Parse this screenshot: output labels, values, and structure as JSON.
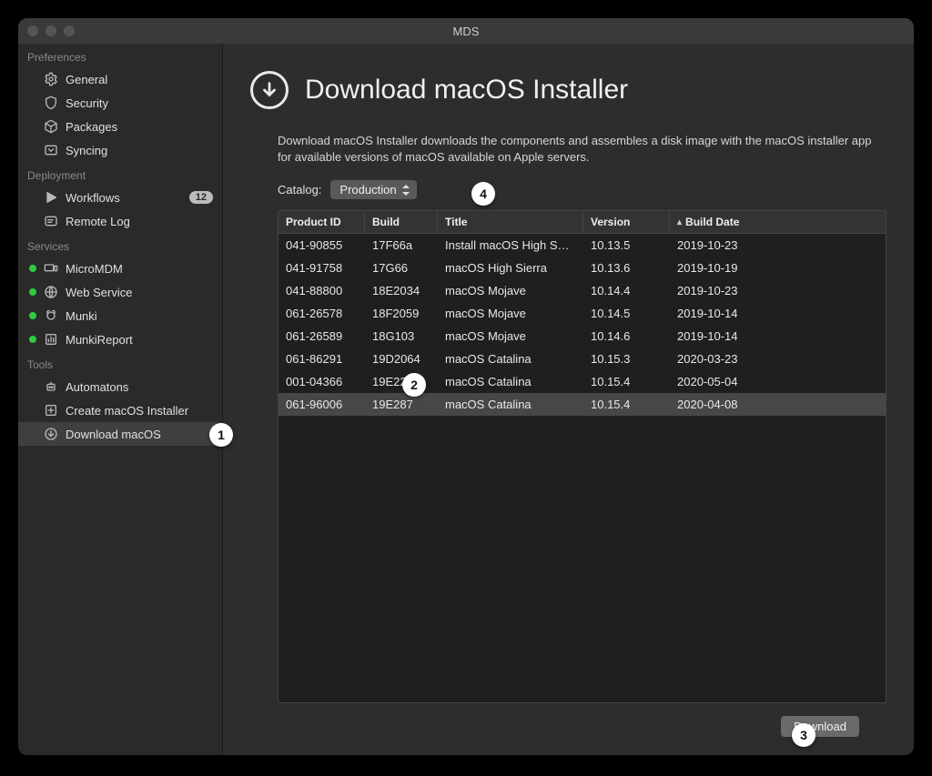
{
  "window": {
    "title": "MDS"
  },
  "sidebar": {
    "sections": [
      {
        "title": "Preferences",
        "items": [
          {
            "label": "General",
            "icon": "gear-icon"
          },
          {
            "label": "Security",
            "icon": "shield-icon"
          },
          {
            "label": "Packages",
            "icon": "package-icon"
          },
          {
            "label": "Syncing",
            "icon": "sync-icon"
          }
        ]
      },
      {
        "title": "Deployment",
        "items": [
          {
            "label": "Workflows",
            "icon": "play-icon",
            "badge": "12"
          },
          {
            "label": "Remote Log",
            "icon": "log-icon"
          }
        ]
      },
      {
        "title": "Services",
        "items": [
          {
            "label": "MicroMDM",
            "icon": "devices-icon",
            "status": "green"
          },
          {
            "label": "Web Service",
            "icon": "globe-icon",
            "status": "green"
          },
          {
            "label": "Munki",
            "icon": "munki-icon",
            "status": "green"
          },
          {
            "label": "MunkiReport",
            "icon": "report-icon",
            "status": "green"
          }
        ]
      },
      {
        "title": "Tools",
        "items": [
          {
            "label": "Automatons",
            "icon": "automaton-icon"
          },
          {
            "label": "Create macOS Installer",
            "icon": "create-installer-icon"
          },
          {
            "label": "Download macOS",
            "icon": "download-icon",
            "selected": true
          }
        ]
      }
    ]
  },
  "main": {
    "heading": "Download macOS Installer",
    "description": "Download macOS Installer downloads the components and assembles a disk image with the macOS installer app for available versions of macOS available on Apple servers.",
    "catalog_label": "Catalog:",
    "catalog_value": "Production",
    "download_button": "Download"
  },
  "table": {
    "sort_column": "Build Date",
    "sort_dir": "asc",
    "columns": [
      "Product ID",
      "Build",
      "Title",
      "Version",
      "Build Date"
    ],
    "rows": [
      {
        "product_id": "041-90855",
        "build": "17F66a",
        "title": "Install macOS High S…",
        "version": "10.13.5",
        "build_date": "2019-10-23"
      },
      {
        "product_id": "041-91758",
        "build": "17G66",
        "title": "macOS High Sierra",
        "version": "10.13.6",
        "build_date": "2019-10-19"
      },
      {
        "product_id": "041-88800",
        "build": "18E2034",
        "title": "macOS Mojave",
        "version": "10.14.4",
        "build_date": "2019-10-23"
      },
      {
        "product_id": "061-26578",
        "build": "18F2059",
        "title": "macOS Mojave",
        "version": "10.14.5",
        "build_date": "2019-10-14"
      },
      {
        "product_id": "061-26589",
        "build": "18G103",
        "title": "macOS Mojave",
        "version": "10.14.6",
        "build_date": "2019-10-14"
      },
      {
        "product_id": "061-86291",
        "build": "19D2064",
        "title": "macOS Catalina",
        "version": "10.15.3",
        "build_date": "2020-03-23"
      },
      {
        "product_id": "001-04366",
        "build": "19E2269",
        "title": "macOS Catalina",
        "version": "10.15.4",
        "build_date": "2020-05-04"
      },
      {
        "product_id": "061-96006",
        "build": "19E287",
        "title": "macOS Catalina",
        "version": "10.15.4",
        "build_date": "2020-04-08",
        "selected": true
      }
    ]
  },
  "callouts": {
    "c1": "1",
    "c2": "2",
    "c3": "3",
    "c4": "4"
  }
}
